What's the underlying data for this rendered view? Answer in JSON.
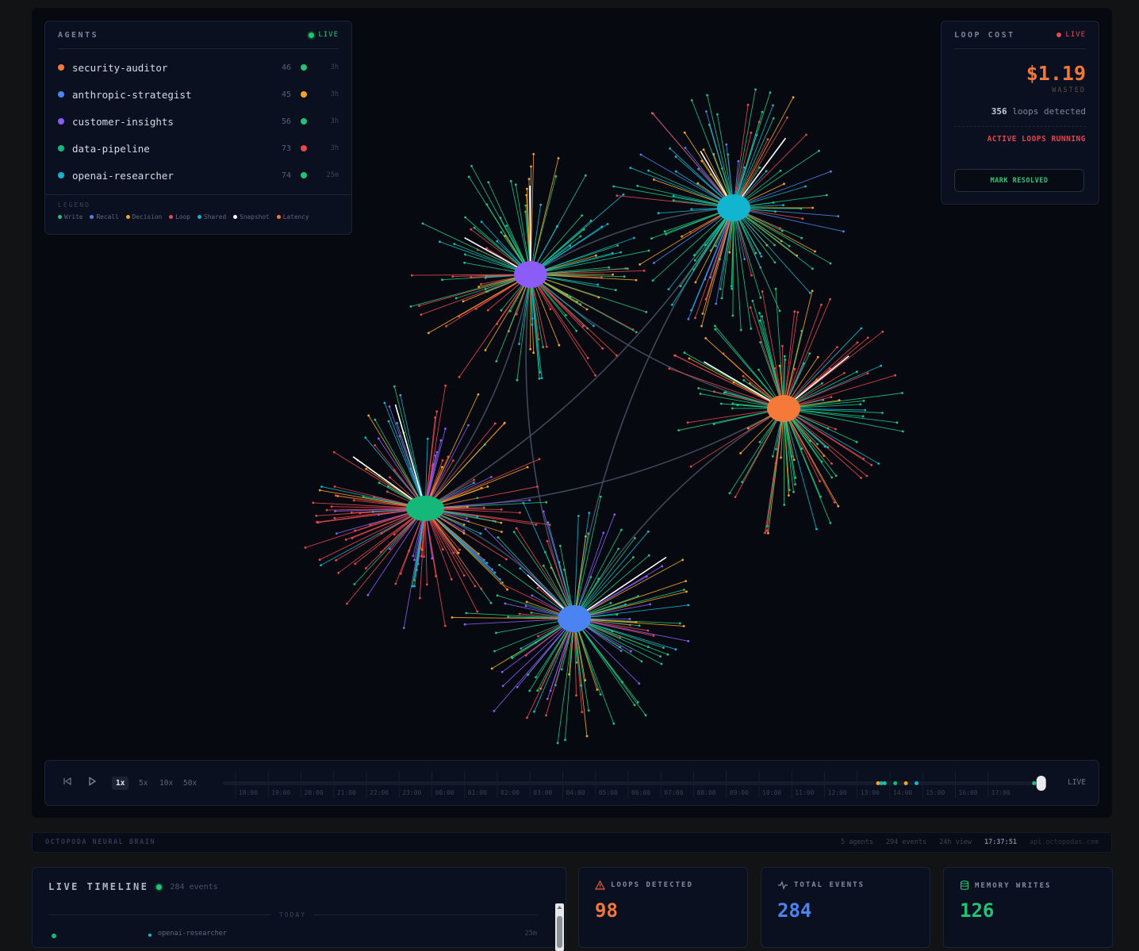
{
  "agents_panel": {
    "title": "AGENTS",
    "live_label": "LIVE",
    "agents": [
      {
        "name": "security-auditor",
        "color": "#f57a3a",
        "count": "46",
        "status_color": "#22c372",
        "time": "3h"
      },
      {
        "name": "anthropic-strategist",
        "color": "#4b84f2",
        "count": "45",
        "status_color": "#f5a524",
        "time": "3h"
      },
      {
        "name": "customer-insights",
        "color": "#8b5cf6",
        "count": "56",
        "status_color": "#22c372",
        "time": "3h"
      },
      {
        "name": "data-pipeline",
        "color": "#16b87a",
        "count": "73",
        "status_color": "#e5484d",
        "time": "3h"
      },
      {
        "name": "openai-researcher",
        "color": "#12b5cf",
        "count": "74",
        "status_color": "#22c372",
        "time": "25m"
      }
    ],
    "legend_title": "LEGEND",
    "legend": [
      {
        "label": "Write",
        "color": "#1fc383"
      },
      {
        "label": "Recall",
        "color": "#4b84f2"
      },
      {
        "label": "Decision",
        "color": "#f5a524"
      },
      {
        "label": "Loop",
        "color": "#e5484d"
      },
      {
        "label": "Shared",
        "color": "#12b5cf"
      },
      {
        "label": "Snapshot",
        "color": "#ffffff"
      },
      {
        "label": "Latency",
        "color": "#f57a3a"
      }
    ]
  },
  "loop_cost": {
    "title": "LOOP COST",
    "live_label": "LIVE",
    "amount": "$1.19",
    "wasted_label": "WASTED",
    "loops_count": "356",
    "loops_label": "loops detected",
    "active_label": "ACTIVE LOOPS RUNNING",
    "resolve_button": "MARK RESOLVED"
  },
  "graph": {
    "nodes": [
      {
        "agent": "customer-insights",
        "color": "#8b5cf6"
      },
      {
        "agent": "openai-researcher",
        "color": "#12b5cf"
      },
      {
        "agent": "security-auditor",
        "color": "#f57a3a"
      },
      {
        "agent": "data-pipeline",
        "color": "#16b87a"
      },
      {
        "agent": "anthropic-strategist",
        "color": "#4b84f2"
      }
    ],
    "edge_color": "#4a5266"
  },
  "playback": {
    "speeds": [
      "1x",
      "5x",
      "10x",
      "50x"
    ],
    "active_speed": "1x",
    "hours": [
      "18:00",
      "19:00",
      "20:00",
      "21:00",
      "22:00",
      "23:00",
      "00:00",
      "01:00",
      "02:00",
      "03:00",
      "04:00",
      "05:00",
      "06:00",
      "07:00",
      "08:00",
      "09:00",
      "10:00",
      "11:00",
      "12:00",
      "13:00",
      "14:00",
      "15:00",
      "16:00",
      "17:00"
    ],
    "position": 0.99,
    "live_label": "LIVE"
  },
  "status_strip": {
    "title": "OCTOPODA NEURAL BRAIN",
    "agents": "5 agents",
    "events": "294 events",
    "view": "24h view",
    "clock": "17:37:51",
    "api": "api.octopodas.com"
  },
  "timeline": {
    "title": "LIVE TIMELINE",
    "count": "284 events",
    "today_label": "TODAY",
    "first_row_agent": "openai-researcher",
    "first_row_time": "25m"
  },
  "stats": [
    {
      "label": "LOOPS DETECTED",
      "value": "98",
      "color": "#f0783a",
      "icon": "warning-icon"
    },
    {
      "label": "TOTAL EVENTS",
      "value": "284",
      "color": "#4b84f2",
      "icon": "pulse-icon"
    },
    {
      "label": "MEMORY WRITES",
      "value": "126",
      "color": "#22c372",
      "icon": "database-icon"
    }
  ]
}
